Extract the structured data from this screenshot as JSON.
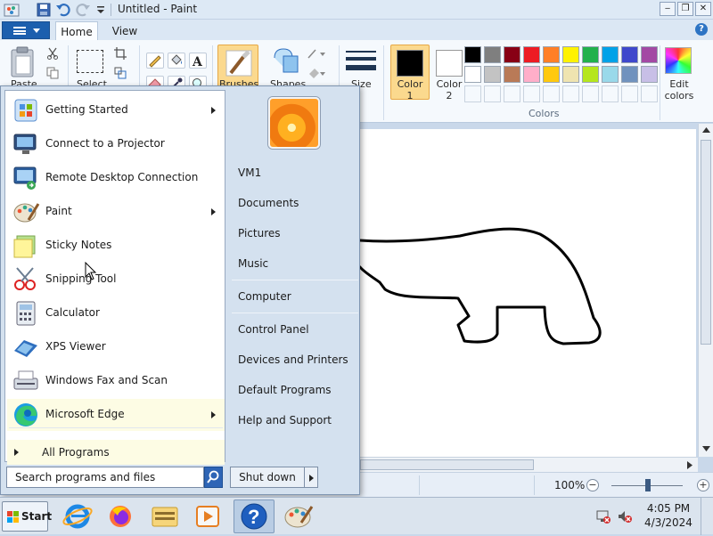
{
  "window": {
    "title": "Untitled - Paint",
    "controls": {
      "minimize": "‒",
      "maximize": "❐",
      "close": "✕"
    }
  },
  "ribbon": {
    "tabs": [
      {
        "label": "Home",
        "active": true
      },
      {
        "label": "View",
        "active": false
      }
    ],
    "help": "?",
    "groups": {
      "paste": "Paste",
      "select": "Select",
      "brushes": "Brushes",
      "shapes": "Shapes",
      "size": "Size",
      "color1_line1": "Color",
      "color1_line2": "1",
      "color2_line1": "Color",
      "color2_line2": "2",
      "colors_group": "Colors",
      "edit_colors_line1": "Edit",
      "edit_colors_line2": "colors"
    },
    "color1": "#000000",
    "color2": "#ffffff",
    "palette_row1": [
      "#000000",
      "#7f7f7f",
      "#880015",
      "#ed1c24",
      "#ff7f27",
      "#fff200",
      "#22b14c",
      "#00a2e8",
      "#3f48cc",
      "#a349a4"
    ],
    "palette_row2": [
      "#ffffff",
      "#c3c3c3",
      "#b97a57",
      "#ffaec9",
      "#ffc90e",
      "#efe4b0",
      "#b5e61d",
      "#99d9ea",
      "#7092be",
      "#c8bfe7"
    ]
  },
  "status": {
    "zoom": "100%",
    "zoom_out": "−",
    "zoom_in": "+"
  },
  "start_menu": {
    "programs": [
      {
        "label": "Getting Started",
        "icon": "getting-started-icon",
        "submenu": true
      },
      {
        "label": "Connect to a Projector",
        "icon": "projector-icon",
        "submenu": false
      },
      {
        "label": "Remote Desktop Connection",
        "icon": "remote-desktop-icon",
        "submenu": false
      },
      {
        "label": "Paint",
        "icon": "paint-icon",
        "submenu": true
      },
      {
        "label": "Sticky Notes",
        "icon": "sticky-notes-icon",
        "submenu": false
      },
      {
        "label": "Snipping Tool",
        "icon": "snipping-tool-icon",
        "submenu": false
      },
      {
        "label": "Calculator",
        "icon": "calculator-icon",
        "submenu": false
      },
      {
        "label": "XPS Viewer",
        "icon": "xps-viewer-icon",
        "submenu": false
      },
      {
        "label": "Windows Fax and Scan",
        "icon": "fax-scan-icon",
        "submenu": false
      },
      {
        "label": "Microsoft Edge",
        "icon": "edge-icon",
        "submenu": true,
        "highlighted": true
      }
    ],
    "all_programs": "All Programs",
    "search_placeholder": "Search programs and files",
    "right_items": [
      "VM1",
      "Documents",
      "Pictures",
      "Music",
      "Computer",
      "Control Panel",
      "Devices and Printers",
      "Default Programs",
      "Help and Support"
    ],
    "shutdown": "Shut down"
  },
  "taskbar": {
    "start": "Start",
    "apps": [
      "internet-explorer-icon",
      "firefox-icon",
      "file-explorer-icon",
      "media-player-icon",
      "help-support-icon",
      "paint-icon"
    ],
    "clock_time": "4:05 PM",
    "clock_date": "4/3/2024"
  }
}
